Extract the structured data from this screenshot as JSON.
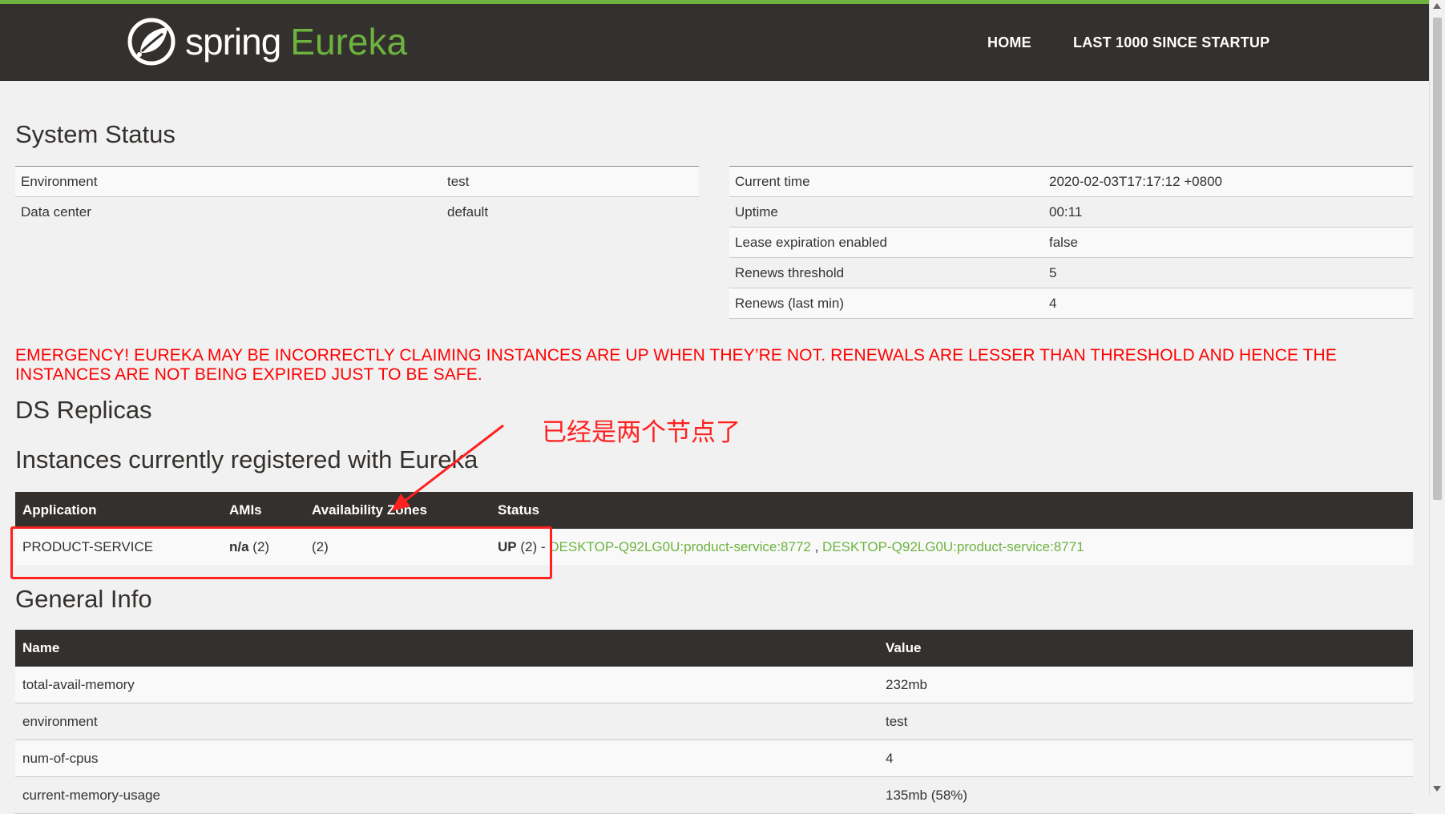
{
  "brand": {
    "spring": "spring",
    "eureka": "Eureka"
  },
  "nav": {
    "home": "HOME",
    "last": "LAST 1000 SINCE STARTUP"
  },
  "system_status": {
    "title": "System Status",
    "left": [
      {
        "key": "Environment",
        "value": "test"
      },
      {
        "key": "Data center",
        "value": "default"
      }
    ],
    "right": [
      {
        "key": "Current time",
        "value": "2020-02-03T17:17:12 +0800"
      },
      {
        "key": "Uptime",
        "value": "00:11"
      },
      {
        "key": "Lease expiration enabled",
        "value": "false"
      },
      {
        "key": "Renews threshold",
        "value": "5"
      },
      {
        "key": "Renews (last min)",
        "value": "4"
      }
    ]
  },
  "emergency": "EMERGENCY! EUREKA MAY BE INCORRECTLY CLAIMING INSTANCES ARE UP WHEN THEY’RE NOT. RENEWALS ARE LESSER THAN THRESHOLD AND HENCE THE INSTANCES ARE NOT BEING EXPIRED JUST TO BE SAFE.",
  "replicas_title": "DS Replicas",
  "instances": {
    "title": "Instances currently registered with Eureka",
    "headers": [
      "Application",
      "AMIs",
      "Availability Zones",
      "Status"
    ],
    "row": {
      "application": "PRODUCT-SERVICE",
      "amis_bold": "n/a",
      "amis_count": "(2)",
      "zones": "(2)",
      "status_bold": "UP",
      "status_count": "(2)",
      "sep": " - ",
      "link1": "DESKTOP-Q92LG0U:product-service:8772",
      "link_sep": " , ",
      "link2": "DESKTOP-Q92LG0U:product-service:8771"
    }
  },
  "general": {
    "title": "General Info",
    "headers": [
      "Name",
      "Value"
    ],
    "rows": [
      {
        "name": "total-avail-memory",
        "value": "232mb"
      },
      {
        "name": "environment",
        "value": "test"
      },
      {
        "name": "num-of-cpus",
        "value": "4"
      },
      {
        "name": "current-memory-usage",
        "value": "135mb (58%)"
      }
    ]
  },
  "annotation": {
    "text": "已经是两个节点了",
    "color": "#ff2020"
  },
  "colors": {
    "brand_green": "#6db33f",
    "nav_bg": "#34302d",
    "emergency": "#ff0000"
  }
}
